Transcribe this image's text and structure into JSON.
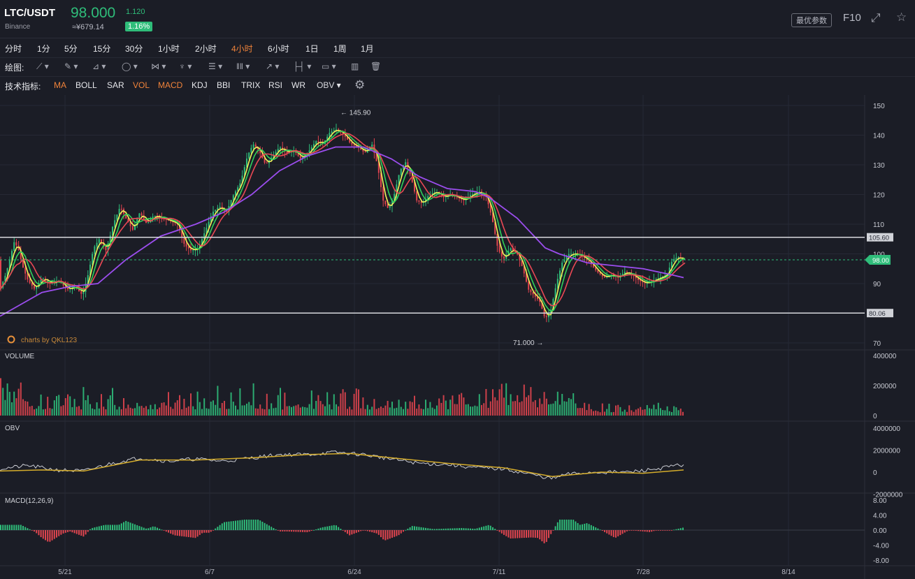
{
  "header": {
    "symbol": "LTC/USDT",
    "exchange": "Binance",
    "price": "98.000",
    "price_cny": "≈¥679.14",
    "change": "1.120",
    "change_pct": "1.16%",
    "optimize_label": "最优参数",
    "f10_label": "F10",
    "fullscreen_icon": "fullscreen-icon",
    "star_icon": "star-icon"
  },
  "timeframes": [
    "分时",
    "1分",
    "5分",
    "15分",
    "30分",
    "1小时",
    "2小时",
    "4小时",
    "6小时",
    "1日",
    "1周",
    "1月"
  ],
  "active_timeframe": "4小时",
  "drawing": {
    "label": "绘图:",
    "tools": [
      "line-tool-icon",
      "pen-tool-icon",
      "channel-tool-icon",
      "circle-tool-icon",
      "fork-tool-icon",
      "pattern-tool-icon",
      "fib-tool-icon",
      "grid-tool-icon",
      "arrow-tool-icon",
      "measure-tool-icon",
      "note-tool-icon",
      "bars-tool-icon",
      "trash-icon"
    ]
  },
  "indicators": {
    "label": "技术指标:",
    "items": [
      "MA",
      "BOLL",
      "SAR",
      "VOL",
      "MACD",
      "KDJ",
      "BBI",
      "TRIX",
      "RSI",
      "WR",
      "OBV"
    ],
    "active": [
      "MA",
      "VOL",
      "MACD"
    ],
    "settings_icon": "gear-icon"
  },
  "watermark": "charts by QKL123",
  "chart_data": [
    {
      "type": "candlestick",
      "title": "",
      "x_ticks": [
        "5/21",
        "6/7",
        "6/24",
        "7/11",
        "7/28",
        "8/14"
      ],
      "y_ticks": [
        150,
        140,
        130,
        120,
        110,
        100,
        90,
        70
      ],
      "ylim": [
        68,
        152
      ],
      "close_path": [
        [
          0,
          88
        ],
        [
          8,
          93
        ],
        [
          14,
          98
        ],
        [
          20,
          104
        ],
        [
          26,
          102
        ],
        [
          32,
          96
        ],
        [
          40,
          91
        ],
        [
          50,
          88
        ],
        [
          60,
          92
        ],
        [
          72,
          90
        ],
        [
          84,
          91
        ],
        [
          96,
          88
        ],
        [
          108,
          89
        ],
        [
          118,
          86
        ],
        [
          126,
          93
        ],
        [
          134,
          102
        ],
        [
          142,
          105
        ],
        [
          152,
          101
        ],
        [
          162,
          110
        ],
        [
          172,
          116
        ],
        [
          180,
          112
        ],
        [
          190,
          108
        ],
        [
          200,
          114
        ],
        [
          210,
          110
        ],
        [
          220,
          113
        ],
        [
          232,
          112
        ],
        [
          244,
          111
        ],
        [
          254,
          110
        ],
        [
          264,
          103
        ],
        [
          274,
          101
        ],
        [
          284,
          102
        ],
        [
          294,
          108
        ],
        [
          304,
          114
        ],
        [
          314,
          116
        ],
        [
          324,
          114
        ],
        [
          332,
          119
        ],
        [
          344,
          124
        ],
        [
          354,
          133
        ],
        [
          362,
          137
        ],
        [
          370,
          135
        ],
        [
          380,
          130
        ],
        [
          390,
          133
        ],
        [
          400,
          136
        ],
        [
          410,
          134
        ],
        [
          420,
          135
        ],
        [
          430,
          132
        ],
        [
          440,
          134
        ],
        [
          452,
          138
        ],
        [
          462,
          137
        ],
        [
          472,
          141
        ],
        [
          482,
          142
        ],
        [
          492,
          140
        ],
        [
          502,
          137
        ],
        [
          512,
          136
        ],
        [
          522,
          134
        ],
        [
          532,
          137
        ],
        [
          540,
          130
        ],
        [
          548,
          118
        ],
        [
          556,
          115
        ],
        [
          564,
          120
        ],
        [
          572,
          128
        ],
        [
          580,
          131
        ],
        [
          588,
          126
        ],
        [
          596,
          118
        ],
        [
          604,
          117
        ],
        [
          614,
          120
        ],
        [
          624,
          121
        ],
        [
          634,
          119
        ],
        [
          644,
          120
        ],
        [
          654,
          119
        ],
        [
          664,
          118
        ],
        [
          674,
          120
        ],
        [
          686,
          121
        ],
        [
          696,
          119
        ],
        [
          704,
          112
        ],
        [
          712,
          102
        ],
        [
          720,
          98
        ],
        [
          730,
          102
        ],
        [
          740,
          100
        ],
        [
          748,
          95
        ],
        [
          756,
          88
        ],
        [
          764,
          86
        ],
        [
          772,
          84
        ],
        [
          780,
          78
        ],
        [
          788,
          81
        ],
        [
          796,
          90
        ],
        [
          804,
          97
        ],
        [
          814,
          100
        ],
        [
          824,
          100
        ],
        [
          834,
          99
        ],
        [
          844,
          97
        ],
        [
          854,
          94
        ],
        [
          864,
          92
        ],
        [
          874,
          93
        ],
        [
          884,
          92
        ],
        [
          894,
          94
        ],
        [
          904,
          93
        ],
        [
          914,
          91
        ],
        [
          924,
          90
        ],
        [
          934,
          91
        ],
        [
          944,
          92
        ],
        [
          954,
          93
        ],
        [
          962,
          98
        ],
        [
          970,
          99
        ],
        [
          978,
          98
        ]
      ],
      "ma_purple": [
        [
          0,
          79
        ],
        [
          30,
          83
        ],
        [
          60,
          87
        ],
        [
          100,
          89
        ],
        [
          140,
          90
        ],
        [
          180,
          98
        ],
        [
          230,
          106
        ],
        [
          280,
          110
        ],
        [
          320,
          114
        ],
        [
          360,
          120
        ],
        [
          400,
          128
        ],
        [
          440,
          133
        ],
        [
          480,
          136
        ],
        [
          520,
          136
        ],
        [
          560,
          132
        ],
        [
          600,
          126
        ],
        [
          640,
          122
        ],
        [
          680,
          121
        ],
        [
          700,
          119
        ],
        [
          740,
          112
        ],
        [
          780,
          102
        ],
        [
          800,
          100
        ],
        [
          840,
          97
        ],
        [
          880,
          96
        ],
        [
          920,
          95
        ],
        [
          960,
          93
        ],
        [
          978,
          92
        ]
      ],
      "ma_red_offset": 4,
      "annotations": {
        "high_label": "← 145.90",
        "high_value": 145.9,
        "low_label": "71.000 →",
        "low_value": 71.0
      },
      "horizontal_lines": [
        {
          "value": 105.6,
          "label": "105.60"
        },
        {
          "value": 80.06,
          "label": "80.06"
        }
      ],
      "current_price": {
        "value": 98.0,
        "label": "98.00"
      }
    },
    {
      "type": "bar",
      "title": "VOLUME",
      "y_ticks": [
        400000,
        200000,
        0
      ],
      "ylim": [
        0,
        420000
      ]
    },
    {
      "type": "line",
      "title": "OBV",
      "y_ticks": [
        4000000,
        2000000,
        0,
        -2000000
      ],
      "ylim": [
        -2000000,
        4000000
      ],
      "obv": [
        [
          0,
          0.3
        ],
        [
          40,
          0.6
        ],
        [
          80,
          0.2
        ],
        [
          120,
          0.1
        ],
        [
          160,
          0.8
        ],
        [
          200,
          1.3
        ],
        [
          240,
          1.0
        ],
        [
          280,
          1.2
        ],
        [
          320,
          1.0
        ],
        [
          360,
          1.3
        ],
        [
          400,
          1.6
        ],
        [
          440,
          1.6
        ],
        [
          480,
          1.8
        ],
        [
          520,
          1.6
        ],
        [
          560,
          1.2
        ],
        [
          600,
          0.8
        ],
        [
          640,
          0.7
        ],
        [
          680,
          0.4
        ],
        [
          720,
          0.3
        ],
        [
          760,
          -0.2
        ],
        [
          790,
          -0.6
        ],
        [
          810,
          -0.2
        ],
        [
          850,
          0.0
        ],
        [
          900,
          0.0
        ],
        [
          940,
          0.3
        ],
        [
          978,
          0.7
        ]
      ],
      "obv_ma": [
        [
          0,
          0.1
        ],
        [
          60,
          0.2
        ],
        [
          120,
          0.1
        ],
        [
          200,
          1.1
        ],
        [
          280,
          1.1
        ],
        [
          360,
          1.3
        ],
        [
          440,
          1.6
        ],
        [
          500,
          1.7
        ],
        [
          560,
          1.3
        ],
        [
          640,
          0.8
        ],
        [
          720,
          0.4
        ],
        [
          790,
          -0.4
        ],
        [
          860,
          0.0
        ],
        [
          920,
          -0.1
        ],
        [
          978,
          0.2
        ]
      ]
    },
    {
      "type": "line",
      "title": "MACD(12,26,9)",
      "y_ticks": [
        8,
        4,
        0,
        -4,
        -8
      ],
      "y_tick_labels": [
        "8.00",
        "4.00",
        "0.00",
        "-4.00",
        "-8.00"
      ],
      "ylim": [
        -8,
        8
      ],
      "dif": [
        [
          0,
          2
        ],
        [
          30,
          4
        ],
        [
          50,
          2
        ],
        [
          70,
          -1
        ],
        [
          100,
          -0.5
        ],
        [
          120,
          -2
        ],
        [
          150,
          2
        ],
        [
          180,
          5
        ],
        [
          220,
          4
        ],
        [
          250,
          0
        ],
        [
          280,
          -2
        ],
        [
          300,
          -1
        ],
        [
          320,
          2
        ],
        [
          350,
          4
        ],
        [
          370,
          5
        ],
        [
          400,
          2
        ],
        [
          440,
          1
        ],
        [
          480,
          2
        ],
        [
          500,
          0
        ],
        [
          520,
          -1
        ],
        [
          550,
          -5
        ],
        [
          570,
          -4
        ],
        [
          590,
          -2
        ],
        [
          620,
          -2
        ],
        [
          660,
          -1
        ],
        [
          700,
          -0.5
        ],
        [
          730,
          -4
        ],
        [
          760,
          -5
        ],
        [
          780,
          -6
        ],
        [
          800,
          0
        ],
        [
          820,
          2
        ],
        [
          840,
          2
        ],
        [
          860,
          0
        ],
        [
          880,
          -2
        ],
        [
          900,
          -1
        ],
        [
          930,
          -1
        ],
        [
          960,
          0.5
        ],
        [
          978,
          2
        ]
      ],
      "dea": [
        [
          0,
          1
        ],
        [
          30,
          3
        ],
        [
          60,
          2
        ],
        [
          90,
          0
        ],
        [
          130,
          -1
        ],
        [
          170,
          3
        ],
        [
          210,
          4
        ],
        [
          250,
          1
        ],
        [
          290,
          -1
        ],
        [
          330,
          1
        ],
        [
          370,
          3
        ],
        [
          410,
          2
        ],
        [
          460,
          1
        ],
        [
          500,
          1
        ],
        [
          540,
          -3
        ],
        [
          580,
          -3
        ],
        [
          630,
          -2
        ],
        [
          680,
          -1
        ],
        [
          720,
          -2
        ],
        [
          770,
          -4
        ],
        [
          800,
          -2
        ],
        [
          830,
          1
        ],
        [
          860,
          0
        ],
        [
          900,
          -1
        ],
        [
          940,
          -0.5
        ],
        [
          978,
          1.5
        ]
      ]
    }
  ]
}
